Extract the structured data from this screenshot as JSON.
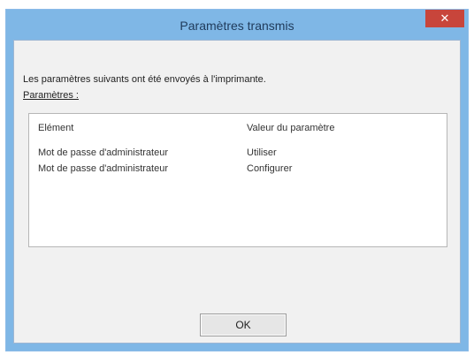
{
  "window": {
    "title": "Paramètres transmis",
    "close_symbol": "✕"
  },
  "message": "Les paramètres suivants ont été envoyés à l'imprimante.",
  "params_label": "Paramètres :",
  "list": {
    "headers": [
      "Elément",
      "Valeur du paramètre"
    ],
    "rows": [
      [
        "Mot de passe d'administrateur",
        "Utiliser"
      ],
      [
        "Mot de passe d'administrateur",
        "Configurer"
      ]
    ]
  },
  "buttons": {
    "ok": "OK"
  },
  "colors": {
    "title_bar": "#7fb7e6",
    "close_button": "#c8453b",
    "dialog_background": "#f1f1f1"
  },
  "icons": {
    "close": "close-icon"
  }
}
